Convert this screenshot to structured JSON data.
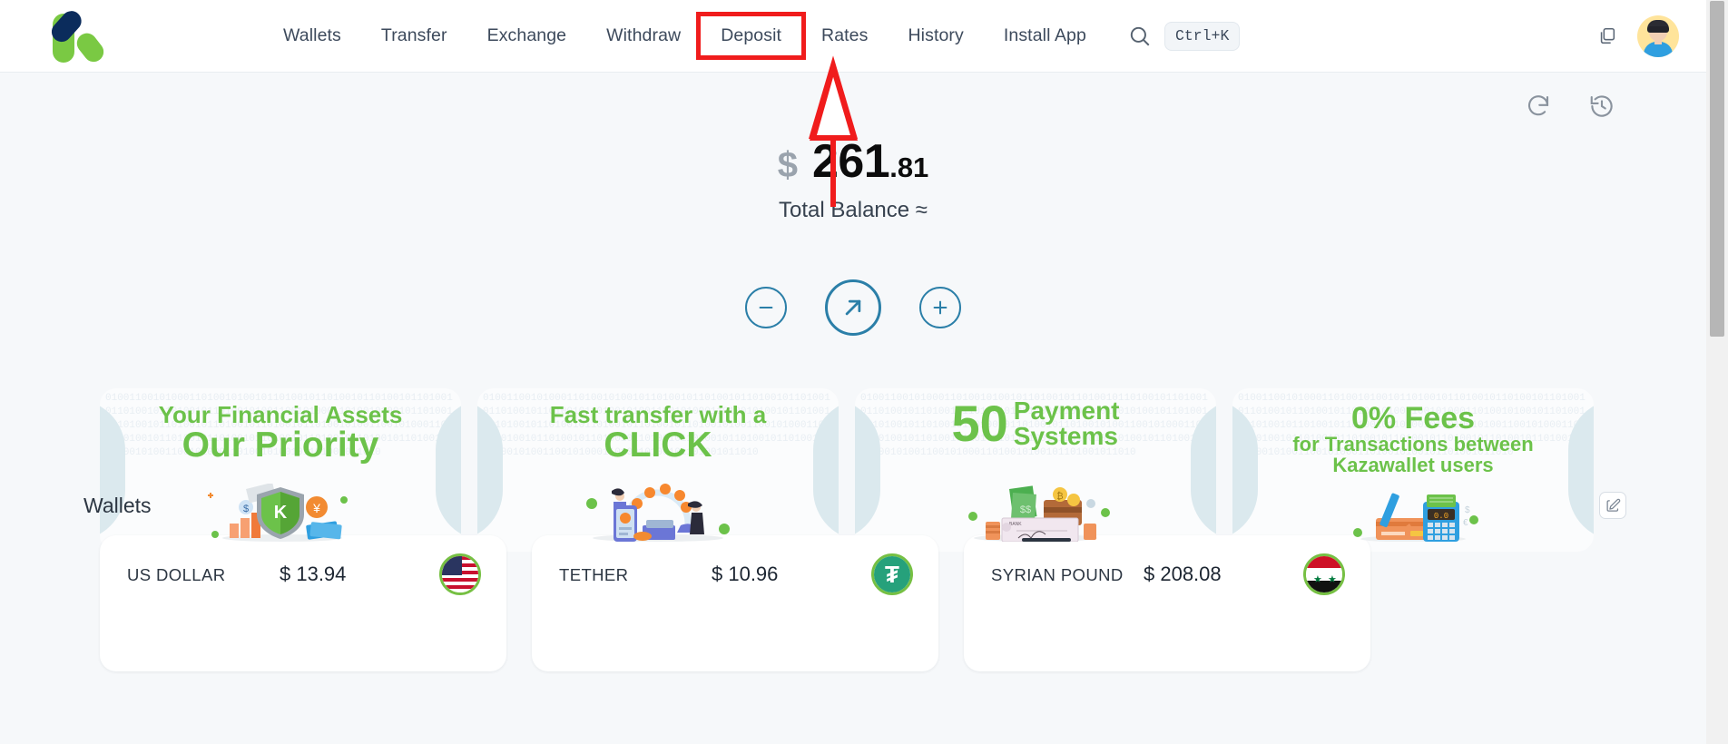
{
  "header": {
    "logo_name": "kazawallet-logo",
    "nav": [
      {
        "label": "Wallets",
        "highlighted": false
      },
      {
        "label": "Transfer",
        "highlighted": false
      },
      {
        "label": "Exchange",
        "highlighted": false
      },
      {
        "label": "Withdraw",
        "highlighted": false
      },
      {
        "label": "Deposit",
        "highlighted": true
      },
      {
        "label": "Rates",
        "highlighted": false
      },
      {
        "label": "History",
        "highlighted": false
      },
      {
        "label": "Install App",
        "highlighted": false
      }
    ],
    "search_icon": "search-icon",
    "search_shortcut": "Ctrl+K",
    "copy_icon": "copy-icon",
    "avatar_icon": "user-avatar"
  },
  "toolbar": {
    "refresh_icon": "refresh-icon",
    "history_icon": "clock-history-icon"
  },
  "balance": {
    "currency_symbol": "$",
    "integer": "261",
    "decimal": ".81",
    "label": "Total Balance ≈"
  },
  "actions": [
    {
      "name": "withdraw-action-button",
      "icon": "minus-circle-icon"
    },
    {
      "name": "transfer-action-button",
      "icon": "arrow-up-right-circle-icon"
    },
    {
      "name": "deposit-action-button",
      "icon": "plus-circle-icon"
    }
  ],
  "banners": [
    {
      "line1": "Your Financial Assets",
      "line2": "Our Priority",
      "line3": "",
      "art": "shield-money-illustration"
    },
    {
      "line1": "Fast transfer with a",
      "line2": "CLICK",
      "line3": "",
      "art": "people-phone-coins-illustration"
    },
    {
      "line1": "50",
      "line2": "Payment",
      "line3": "Systems",
      "art": "check-cash-wallet-illustration"
    },
    {
      "line1": "0% Fees",
      "line2": "for Transactions between",
      "line3": "Kazawallet users",
      "art": "card-calculator-pen-illustration"
    }
  ],
  "wallets_section": {
    "title": "Wallets",
    "edit_icon": "edit-pencil-icon",
    "cards": [
      {
        "name": "US DOLLAR",
        "usd_value": "$ 13.94",
        "flag": "us-flag-icon"
      },
      {
        "name": "TETHER",
        "usd_value": "$ 10.96",
        "flag": "tether-icon"
      },
      {
        "name": "SYRIAN POUND",
        "usd_value": "$ 208.08",
        "flag": "syria-flag-icon"
      }
    ]
  },
  "annotation": {
    "type": "red-arrow-and-box",
    "points_to": "Deposit",
    "color": "#f01c1c"
  },
  "colors": {
    "brand_green": "#7ac943",
    "brand_navy": "#0b2c5c",
    "accent_blue": "#2b7fa8",
    "annotation_red": "#f01c1c",
    "page_bg": "#f6f8fa"
  }
}
